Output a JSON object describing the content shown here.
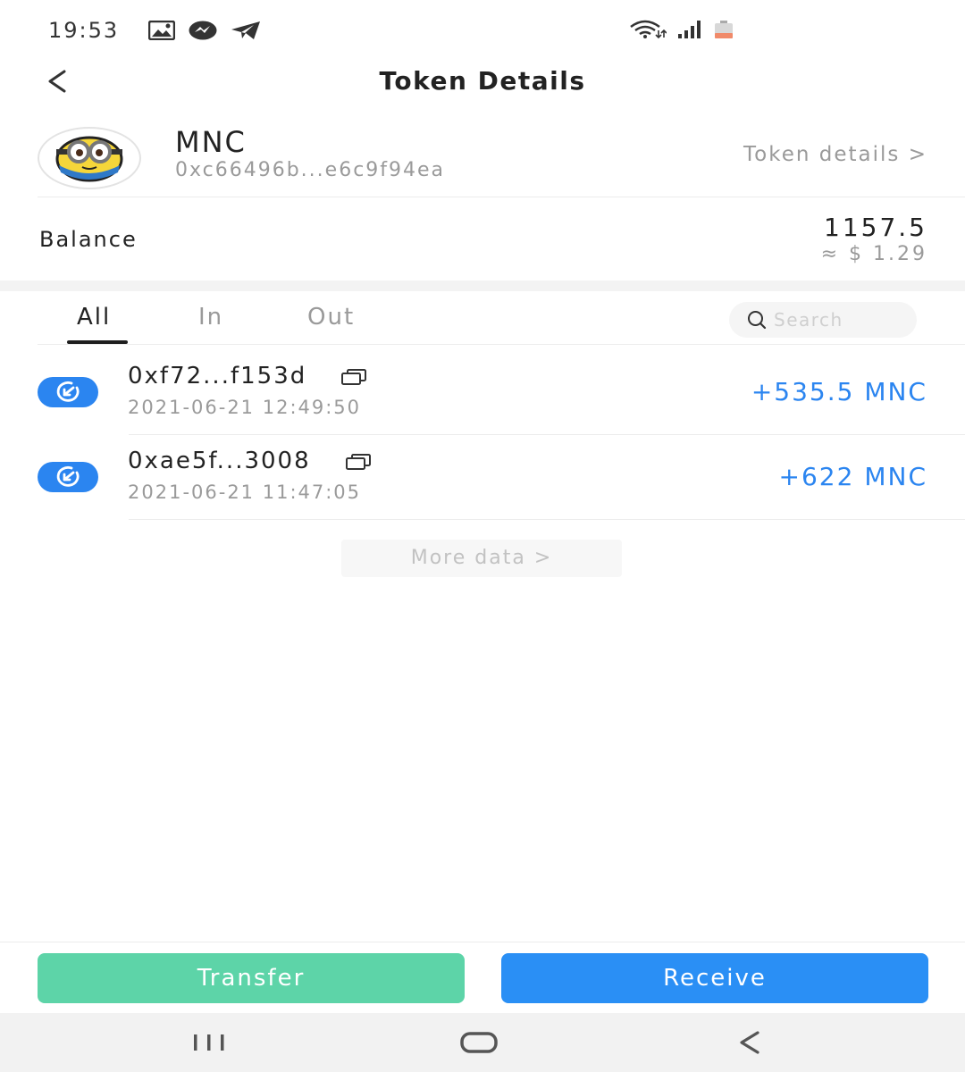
{
  "status_bar": {
    "time": "19:53",
    "icons_left": [
      "image-icon",
      "messenger-icon",
      "telegram-icon"
    ],
    "icons_right": [
      "wifi-icon",
      "signal-icon",
      "battery-icon"
    ]
  },
  "header": {
    "title": "Token Details",
    "back_icon": "chevron-left-icon"
  },
  "token": {
    "symbol": "MNC",
    "address": "0xc66496b...e6c9f94ea",
    "details_link": "Token details >"
  },
  "balance": {
    "label": "Balance",
    "amount": "1157.5",
    "fiat": "≈ $ 1.29"
  },
  "tabs": {
    "all": "All",
    "in": "In",
    "out": "Out",
    "selected": "All"
  },
  "search": {
    "placeholder": "Search",
    "value": ""
  },
  "transactions": [
    {
      "address": "0xf72...f153d",
      "time": "2021-06-21 12:49:50",
      "amount": "+535.5 MNC",
      "direction": "in"
    },
    {
      "address": "0xae5f...3008",
      "time": "2021-06-21 11:47:05",
      "amount": "+622 MNC",
      "direction": "in"
    }
  ],
  "more_data": "More data >",
  "actions": {
    "transfer": "Transfer",
    "receive": "Receive"
  },
  "colors": {
    "accent_blue": "#2b85f0",
    "transfer_green": "#5dd4a8",
    "receive_blue": "#2a8ff5",
    "muted_text": "#9a9a9a"
  },
  "nav": [
    "recent-apps-icon",
    "home-icon",
    "back-icon"
  ]
}
